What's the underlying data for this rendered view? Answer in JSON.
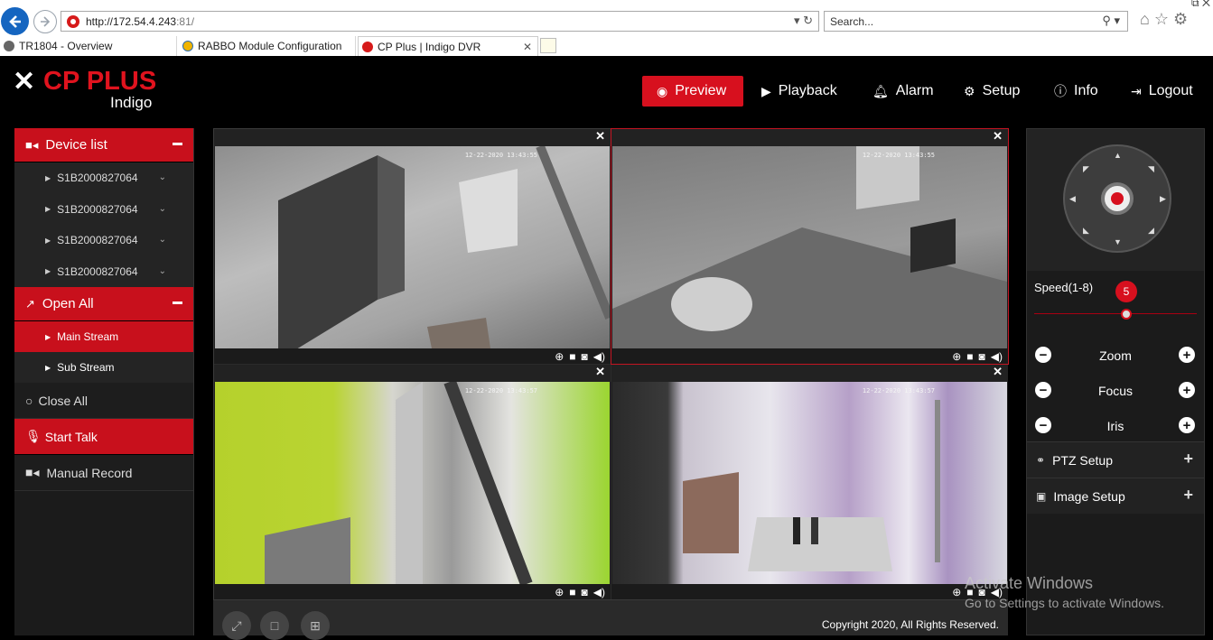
{
  "browser": {
    "url": "http://172.54.4.243",
    "url_port": ":81/",
    "search_placeholder": "Search...",
    "tabs": [
      {
        "label": "TR1804 - Overview"
      },
      {
        "label": "RABBO Module Configuration"
      },
      {
        "label": "CP Plus | Indigo DVR"
      }
    ]
  },
  "logo": {
    "brand": "CP PLUS",
    "sub": "Indigo"
  },
  "topnav": {
    "preview": "Preview",
    "playback": "Playback",
    "alarm": "Alarm",
    "setup": "Setup",
    "info": "Info",
    "logout": "Logout"
  },
  "sidebar": {
    "device_list": "Device list",
    "devices": [
      "S1B2000827064",
      "S1B2000827064",
      "S1B2000827064",
      "S1B2000827064"
    ],
    "open_all": "Open All",
    "main_stream": "Main Stream",
    "sub_stream": "Sub Stream",
    "close_all": "Close All",
    "start_talk": "Start Talk",
    "manual_record": "Manual Record"
  },
  "video": {
    "panes": [
      {
        "timestamp": "12-22-2020 13:43:55"
      },
      {
        "timestamp": "12-22-2020 13:43:55"
      },
      {
        "timestamp": "12-22-2020 13:43:57"
      },
      {
        "timestamp": "12-22-2020 13:43:57"
      }
    ],
    "copyright": "Copyright 2020, All Rights Reserved."
  },
  "ptz": {
    "speed_label": "Speed(1-8)",
    "speed_value": "5",
    "zoom": "Zoom",
    "focus": "Focus",
    "iris": "Iris",
    "ptz_setup": "PTZ Setup",
    "image_setup": "Image Setup"
  },
  "watermark": {
    "line1": "Activate Windows",
    "line2": "Go to Settings to activate Windows."
  },
  "colors": {
    "accent": "#d7101e",
    "background": "#000000",
    "panel": "#1b1b1b"
  }
}
